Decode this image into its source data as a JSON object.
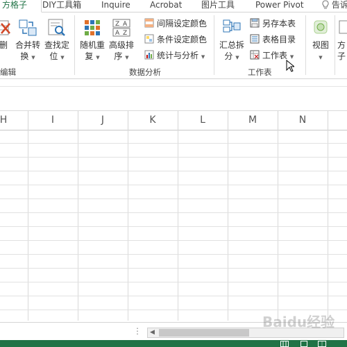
{
  "tabs": [
    {
      "label": "方格子",
      "active": true
    },
    {
      "label": "DIY工具箱"
    },
    {
      "label": "Inquire"
    },
    {
      "label": "Acrobat"
    },
    {
      "label": "图片工具"
    },
    {
      "label": "Power Pivot"
    },
    {
      "label": "告诉"
    }
  ],
  "ribbon": {
    "edit_group": {
      "label": "编辑",
      "delete_btn": "删",
      "merge_btn": {
        "line1": "合并转",
        "line2": "换"
      },
      "find_btn": {
        "line1": "查找定",
        "line2": "位"
      }
    },
    "analysis_group": {
      "label": "数据分析",
      "random_btn": {
        "line1": "随机重",
        "line2": "复"
      },
      "sort_btn": {
        "line1": "高级排",
        "line2": "序"
      },
      "interval_color": "间隔设定颜色",
      "cond_color": "条件设定颜色",
      "stats": "统计与分析"
    },
    "sheet_group": {
      "label": "工作表",
      "summary_btn": {
        "line1": "汇总拆",
        "line2": "分"
      },
      "save_sheet": "另存本表",
      "sheet_index": "表格目录",
      "worksheet": "工作表"
    },
    "view_group": {
      "view_btn": "视图",
      "fang_btn": {
        "line1": "方",
        "line2": "子"
      }
    }
  },
  "columns": [
    "H",
    "I",
    "J",
    "K",
    "L",
    "M",
    "N"
  ],
  "watermark": "Baidu经验",
  "colors": {
    "accent": "#217346",
    "grid": "#d9d9d9"
  }
}
